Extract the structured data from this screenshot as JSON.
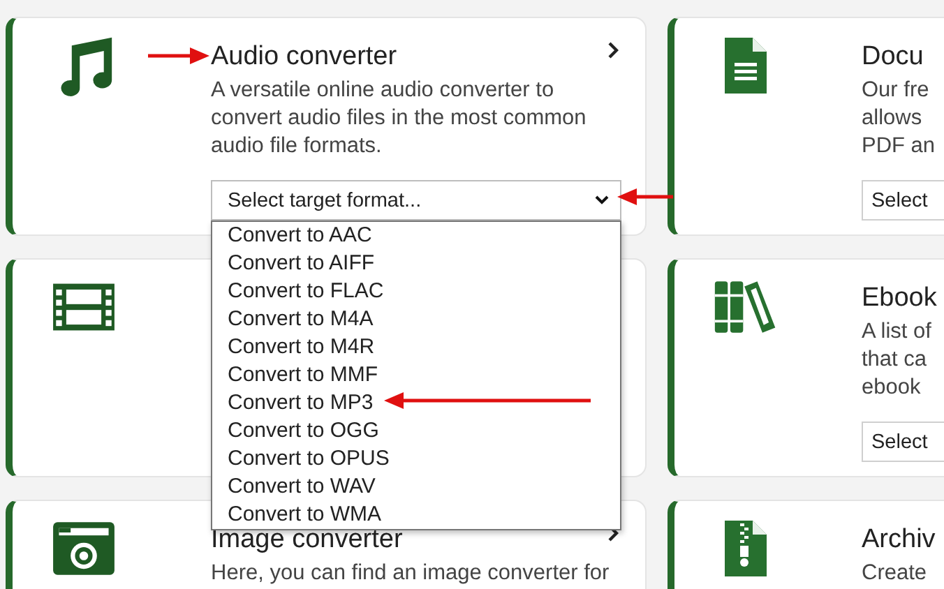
{
  "cards": [
    {
      "title": "Audio converter",
      "chevron": true,
      "description_lines": [
        "A versatile online audio converter to",
        "convert audio files in the most common",
        "audio file formats."
      ],
      "select": {
        "value": "Select target format...",
        "open": true,
        "options": [
          "Convert to AAC",
          "Convert to AIFF",
          "Convert to FLAC",
          "Convert to M4A",
          "Convert to M4R",
          "Convert to MMF",
          "Convert to MP3",
          "Convert to OGG",
          "Convert to OPUS",
          "Convert to WAV",
          "Convert to WMA"
        ]
      }
    },
    {
      "title": "Docu",
      "chevron": false,
      "description_lines": [
        "Our fre",
        "allows",
        "PDF an"
      ],
      "select": {
        "value": "Select",
        "open": false
      }
    },
    {
      "chevron": false
    },
    {
      "title": "Ebook",
      "chevron": false,
      "description_lines": [
        "A list of",
        "that ca",
        "ebook"
      ],
      "select": {
        "value": "Select",
        "open": false
      }
    },
    {
      "title": "Image converter",
      "chevron": true,
      "description_lines": [
        "Here, you can find an image converter for"
      ]
    },
    {
      "title": "Archiv",
      "chevron": false,
      "description_lines": [
        "Create"
      ]
    }
  ]
}
